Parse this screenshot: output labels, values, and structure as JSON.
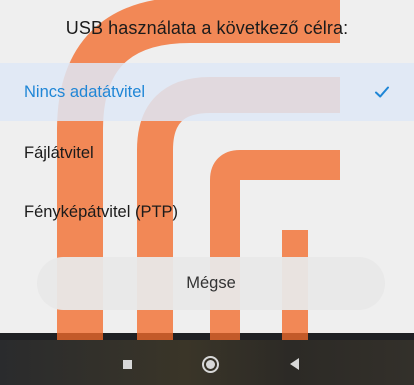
{
  "dialog": {
    "title": "USB használata a következő célra:",
    "options": [
      {
        "label": "Nincs adatátvitel",
        "selected": true
      },
      {
        "label": "Fájlátvitel",
        "selected": false
      },
      {
        "label": "Fényképátvitel (PTP)",
        "selected": false
      }
    ],
    "cancel_label": "Mégse"
  },
  "navbar": {
    "buttons": [
      "recents-square-icon",
      "home-circle-icon",
      "back-triangle-icon"
    ]
  },
  "colors": {
    "accent": "#1f86d6",
    "selected_row_bg": "#dee8f6",
    "cancel_bg": "#e8e8e8",
    "watermark": "#f26a2a"
  }
}
